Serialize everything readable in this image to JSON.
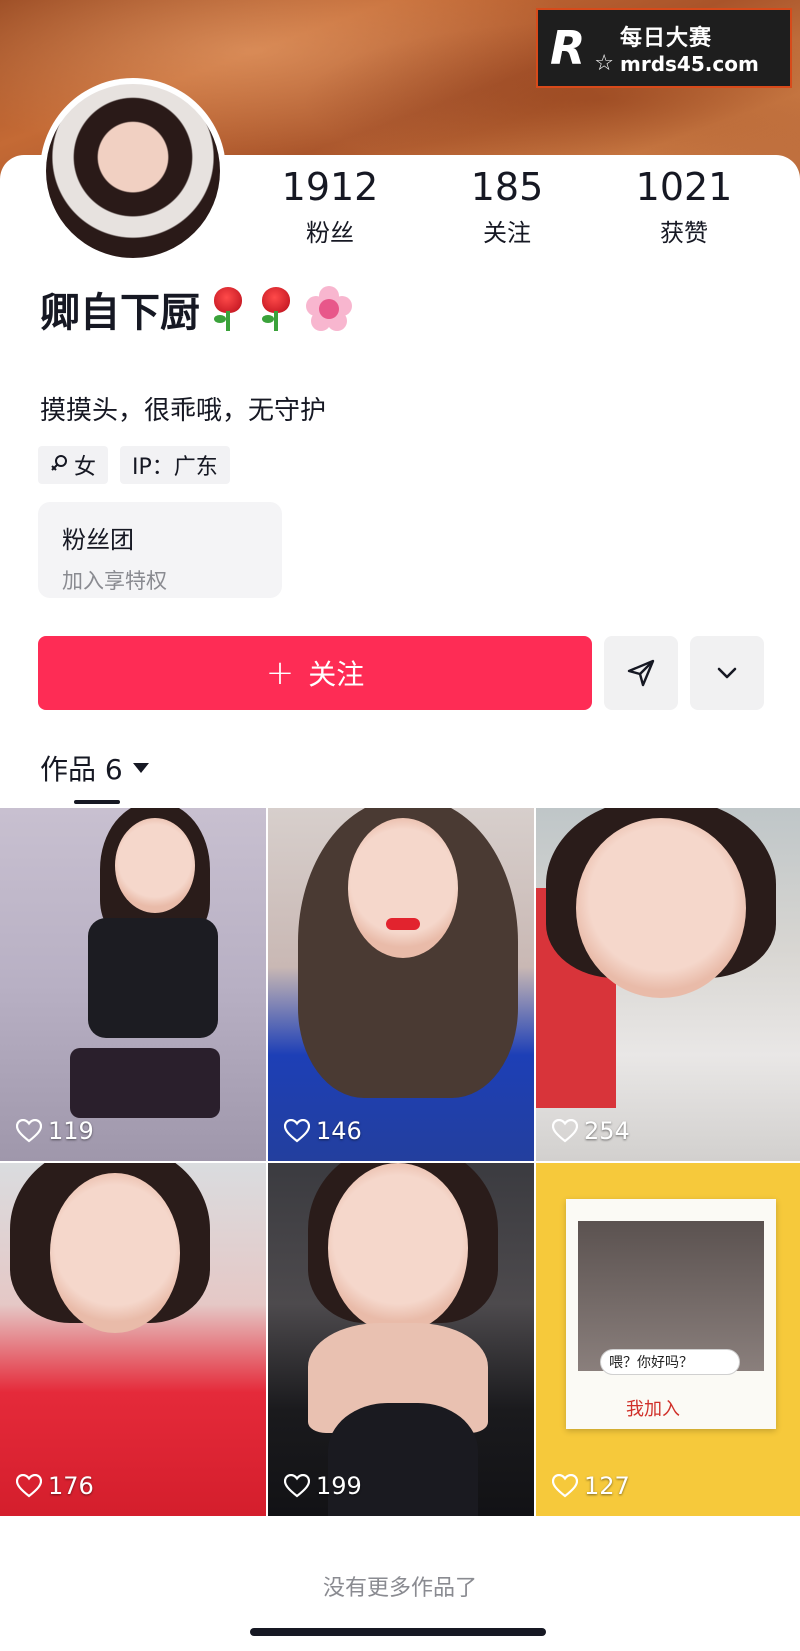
{
  "watermark": {
    "logo_letter": "R",
    "title": "每日大赛",
    "url": "mrds45.com"
  },
  "profile": {
    "nickname": "卿自下厨",
    "bio": "摸摸头，很乖哦，无守护",
    "gender_tag": "女",
    "ip_tag": "IP：广东",
    "stats": [
      {
        "value": "1912",
        "label": "粉丝"
      },
      {
        "value": "185",
        "label": "关注"
      },
      {
        "value": "1021",
        "label": "获赞"
      }
    ]
  },
  "fan_club": {
    "title": "粉丝团",
    "subtitle": "加入享特权"
  },
  "actions": {
    "follow_label": "关注",
    "follow_icon": "plus-icon",
    "share_icon": "send-icon",
    "more_icon": "chevron-down-icon"
  },
  "works": {
    "tab_label": "作品 6",
    "items": [
      {
        "likes": "119"
      },
      {
        "likes": "146"
      },
      {
        "likes": "254"
      },
      {
        "likes": "176"
      },
      {
        "likes": "199"
      },
      {
        "likes": "127"
      }
    ],
    "polaroid_bubble": "喂？你好吗？",
    "polaroid_note": "我加入"
  },
  "footer": {
    "no_more_text": "没有更多作品了"
  },
  "colors": {
    "accent": "#fe2c55",
    "text": "#161823",
    "muted": "#8a8b91"
  }
}
